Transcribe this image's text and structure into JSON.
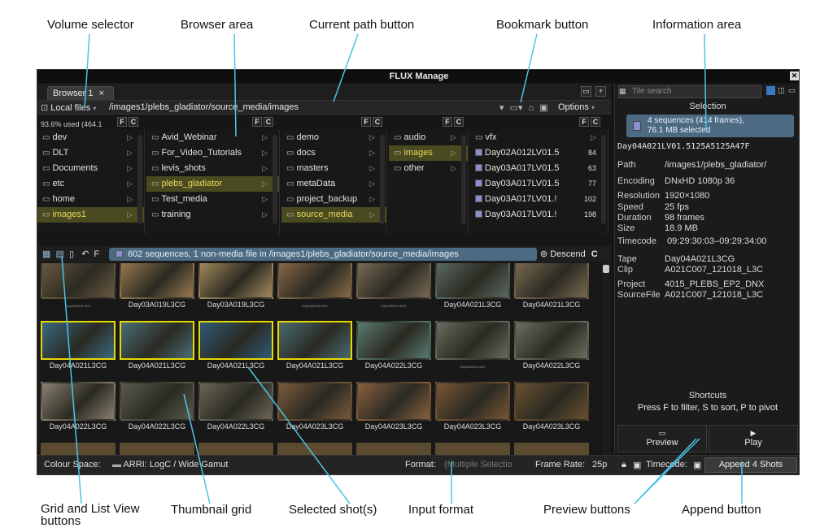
{
  "callouts": {
    "volume_selector": "Volume selector",
    "browser_area": "Browser area",
    "current_path_button": "Current path button",
    "bookmark_button": "Bookmark button",
    "information_area": "Information area",
    "grid_list_buttons": "Grid and List View buttons",
    "thumbnail_grid": "Thumbnail grid",
    "selected_shots": "Selected shot(s)",
    "input_format": "Input format",
    "preview_buttons": "Preview buttons",
    "append_button": "Append button"
  },
  "window": {
    "title": "FLUX Manage",
    "close_icon": "x-icon"
  },
  "tabs": [
    {
      "label": "Browser 1",
      "close": "×"
    }
  ],
  "pathbar": {
    "volume": "Local files",
    "path": "/images1/plebs_gladiator/source_media/images",
    "options": "Options"
  },
  "usage": "93.6% used (464.1",
  "columns": [
    {
      "items": [
        {
          "label": "dev"
        },
        {
          "label": "DLT"
        },
        {
          "label": "Documents"
        },
        {
          "label": "etc"
        },
        {
          "label": "home"
        },
        {
          "label": "images1",
          "selected": true
        }
      ]
    },
    {
      "items": [
        {
          "label": "Avid_Webinar"
        },
        {
          "label": "For_Video_Tutorials"
        },
        {
          "label": "levis_shots"
        },
        {
          "label": "plebs_gladiator",
          "selected": true
        },
        {
          "label": "Test_media"
        },
        {
          "label": "training"
        }
      ]
    },
    {
      "items": [
        {
          "label": "demo"
        },
        {
          "label": "docs"
        },
        {
          "label": "masters"
        },
        {
          "label": "metaData"
        },
        {
          "label": "project_backup"
        },
        {
          "label": "source_media",
          "selected": true
        }
      ]
    },
    {
      "items": [
        {
          "label": "audio"
        },
        {
          "label": "images",
          "selected": true
        },
        {
          "label": "other"
        }
      ]
    },
    {
      "items": [
        {
          "label": "vfx"
        },
        {
          "label": "Day02A012LV01.5",
          "count": "84"
        },
        {
          "label": "Day03A017LV01.5",
          "count": "63"
        },
        {
          "label": "Day03A017LV01.5",
          "count": "77"
        },
        {
          "label": "Day03A017LV01.!",
          "count": "102"
        },
        {
          "label": "Day03A017LV01.!",
          "count": "198"
        }
      ]
    }
  ],
  "gridbar": {
    "summary": "602 sequences, 1 non-media file in /images1/plebs_gladiator/source_media/images",
    "sort": "Descend"
  },
  "thumbnails": [
    {
      "label": "",
      "tiny": "Day04A021L3CG",
      "selected": false,
      "tone": "#6a5a40"
    },
    {
      "label": "Day03A019L3CG",
      "selected": false,
      "tone": "#9a7a50"
    },
    {
      "label": "Day03A019L3CG",
      "selected": false,
      "tone": "#a58a5c"
    },
    {
      "label": "",
      "tiny": "Day04A021L3CG",
      "selected": false,
      "tone": "#8a6a4a"
    },
    {
      "label": "",
      "tiny": "Day04A021L3CG",
      "selected": false,
      "tone": "#7a6a55"
    },
    {
      "label": "Day04A021L3CG",
      "selected": false,
      "tone": "#5a6a60"
    },
    {
      "label": "Day04A021L3CG",
      "selected": false,
      "tone": "#7a6a50"
    },
    {
      "label": "Day04A021L3CG",
      "selected": true,
      "tone": "#3a6a80"
    },
    {
      "label": "Day04A021L3CG",
      "selected": true,
      "tone": "#4a6e78"
    },
    {
      "label": "Day04A021L3CG",
      "selected": true,
      "tone": "#2e5a78"
    },
    {
      "label": "Day04A021L3CG",
      "selected": true,
      "tone": "#4a6a70"
    },
    {
      "label": "Day04A022L3CG",
      "selected": false,
      "tone": "#5a7a70"
    },
    {
      "label": "",
      "tiny": "Day04A022L3CG",
      "selected": false,
      "tone": "#6a6a60"
    },
    {
      "label": "Day04A022L3CG",
      "selected": false,
      "tone": "#6a7060"
    },
    {
      "label": "Day04A022L3CG",
      "selected": false,
      "tone": "#8a8070"
    },
    {
      "label": "Day04A022L3CG",
      "selected": false,
      "tone": "#5a5a50"
    },
    {
      "label": "Day04A022L3CG",
      "selected": false,
      "tone": "#6a6555"
    },
    {
      "label": "Day04A023L3CG",
      "selected": false,
      "tone": "#7a5a3a"
    },
    {
      "label": "Day04A023L3CG",
      "selected": false,
      "tone": "#8a6040"
    },
    {
      "label": "Day04A023L3CG",
      "selected": false,
      "tone": "#7a5535"
    },
    {
      "label": "Day04A023L3CG",
      "selected": false,
      "tone": "#6a5030"
    }
  ],
  "info": {
    "search_placeholder": "Tile search",
    "selection_header": "Selection",
    "selection_summary_1": "4 sequences (414 frames),",
    "selection_summary_2": "76.1 MB selected",
    "sequence_name": "Day04A021LV01.5125A5125A47F",
    "rows1": [
      {
        "k": "Path",
        "v": "/images1/plebs_gladiator/"
      },
      {
        "k": "Encoding",
        "v": "DNxHD 1080p 36"
      },
      {
        "k": "Resolution",
        "v": "1920×1080"
      },
      {
        "k": "Speed",
        "v": "25 fps"
      },
      {
        "k": "Duration",
        "v": "98 frames"
      },
      {
        "k": "Size",
        "v": "18.9 MB"
      }
    ],
    "timecode_label": "Timecode",
    "timecode_value": "09:29:30:03–09:29:34:00",
    "rows2": [
      {
        "k": "Tape",
        "v": "Day04A021L3CG"
      },
      {
        "k": "Clip",
        "v": "A021C007_121018_L3C"
      },
      {
        "k": "Project",
        "v": "4015_PLEBS_EP2_DNX"
      },
      {
        "k": "SourceFile",
        "v": "A021C007_121018_L3C"
      }
    ],
    "shortcuts_header": "Shortcuts",
    "shortcuts_text": "Press F to filter, S to sort, P to pivot",
    "preview_label": "Preview",
    "play_label": "Play"
  },
  "bottom": {
    "colour_space_label": "Colour Space:",
    "colour_space_value": "ARRI: LogC / Wide Gamut",
    "format_label": "Format:",
    "format_value": "(Multiple Selectio",
    "frame_rate_label": "Frame Rate:",
    "frame_rate_value": "25p",
    "timecode_label": "Timecode:",
    "append_label": "Append 4 Shots"
  }
}
